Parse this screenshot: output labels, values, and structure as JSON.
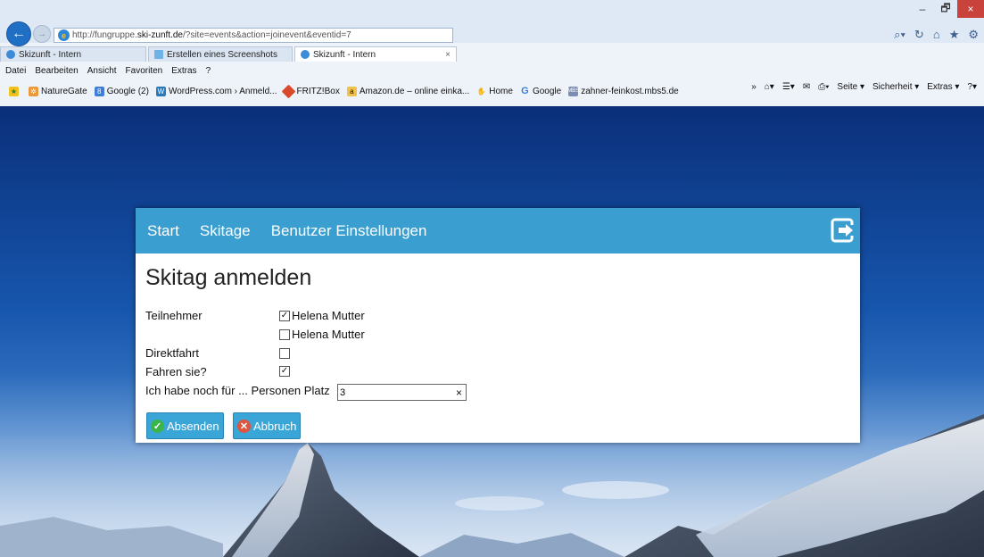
{
  "browser": {
    "url_prefix": "http://fungruppe.",
    "url_domain": "ski-zunft.de",
    "url_suffix": "/?site=events&action=joinevent&eventid=7",
    "tabs": [
      {
        "label": "Skizunft - Intern"
      },
      {
        "label": "Erstellen eines Screenshots"
      },
      {
        "label": "Skizunft - Intern",
        "close": "×"
      }
    ],
    "menu": [
      "Datei",
      "Bearbeiten",
      "Ansicht",
      "Favoriten",
      "Extras",
      "?"
    ],
    "favorites": [
      "NatureGate",
      "Google (2)",
      "WordPress.com › Anmeld...",
      "FRITZ!Box",
      "Amazon.de – online einka...",
      "Home",
      "Google",
      "zahner-feinkost.mbs5.de"
    ],
    "command_bar": {
      "more": "»",
      "page": "Seite ▾",
      "security": "Sicherheit ▾",
      "extras": "Extras ▾"
    },
    "window_controls": {
      "minimize": "–",
      "restore": "🗗",
      "close": "×"
    }
  },
  "app": {
    "nav": [
      "Start",
      "Skitage",
      "Benutzer Einstellungen"
    ],
    "title": "Skitag anmelden",
    "form": {
      "participants_label": "Teilnehmer",
      "participants": [
        {
          "name": "Helena Mutter",
          "checked": true
        },
        {
          "name": "Helena Mutter",
          "checked": false
        }
      ],
      "direct_label": "Direktfahrt",
      "direct_checked": false,
      "driving_label": "Fahren sie?",
      "driving_checked": true,
      "persons_label": "Ich habe noch für ... Personen Platz",
      "persons_value": "3",
      "clear_symbol": "×"
    },
    "buttons": {
      "submit": "Absenden",
      "cancel": "Abbruch"
    }
  },
  "colors": {
    "nav_bg": "#3a9fd0",
    "button_bg": "#3aa6d8",
    "submit_icon": "#3bb54a",
    "cancel_icon": "#e0533d"
  }
}
